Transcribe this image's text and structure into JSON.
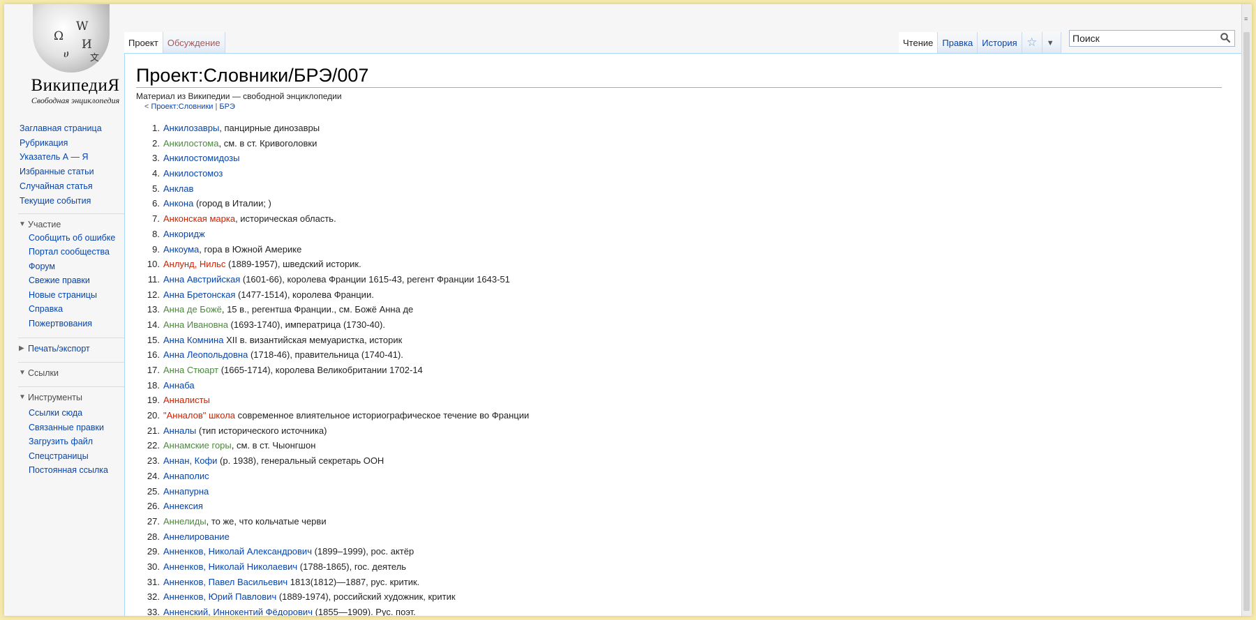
{
  "logo": {
    "wordmark": "ВикипедиЯ",
    "tagline": "Свободная энциклопедия",
    "glyphs": [
      "Ω",
      "W",
      "И",
      "ሀ",
      "文"
    ]
  },
  "sidebar": {
    "main_links": [
      "Заглавная страница",
      "Рубрикация",
      "Указатель А — Я",
      "Избранные статьи",
      "Случайная статья",
      "Текущие события"
    ],
    "participate": {
      "title": "Участие",
      "links": [
        "Сообщить об ошибке",
        "Портал сообщества",
        "Форум",
        "Свежие правки",
        "Новые страницы",
        "Справка",
        "Пожертвования"
      ]
    },
    "print_export": {
      "title": "Печать/экспорт"
    },
    "links_section": {
      "title": "Ссылки"
    },
    "tools": {
      "title": "Инструменты",
      "links": [
        "Ссылки сюда",
        "Связанные правки",
        "Загрузить файл",
        "Спецстраницы",
        "Постоянная ссылка"
      ]
    }
  },
  "tabs": {
    "project": "Проект",
    "discussion": "Обсуждение",
    "read": "Чтение",
    "edit": "Правка",
    "history": "История"
  },
  "search": {
    "placeholder": "Поиск"
  },
  "page": {
    "title": "Проект:Словники/БРЭ/007",
    "subtitle": "Материал из Википедии — свободной энциклопедии",
    "breadcrumb_prefix": "< ",
    "breadcrumb_link1": "Проект:Словники",
    "breadcrumb_sep": " | ",
    "breadcrumb_link2": "БРЭ"
  },
  "colors": {
    "link_blue": "#0645ad",
    "link_green": "#4b8a3c",
    "link_red": "#cc2200",
    "page_border": "#f6eab0"
  },
  "entries": [
    {
      "num": "1.",
      "link": "Анкилозавры",
      "color": "blue",
      "text": ", панцирные динозавры"
    },
    {
      "num": "2.",
      "link": "Анкилостома",
      "color": "green",
      "text": ", см. в ст. Кривоголовки"
    },
    {
      "num": "3.",
      "link": "Анкилостомидозы",
      "color": "blue",
      "text": ""
    },
    {
      "num": "4.",
      "link": "Анкилостомоз",
      "color": "blue",
      "text": ""
    },
    {
      "num": "5.",
      "link": "Анклав",
      "color": "blue",
      "text": ""
    },
    {
      "num": "6.",
      "link": "Анкона",
      "color": "blue",
      "text": " (город в Италии; )"
    },
    {
      "num": "7.",
      "link": "Анконская марка",
      "color": "red",
      "text": ", историческая область."
    },
    {
      "num": "8.",
      "link": "Анкоридж",
      "color": "blue",
      "text": ""
    },
    {
      "num": "9.",
      "link": "Анкоума",
      "color": "blue",
      "text": ", гора в Южной Америке"
    },
    {
      "num": "10.",
      "link": "Анлунд, Нильс",
      "color": "red",
      "text": " (1889-1957), шведский историк."
    },
    {
      "num": "11.",
      "link": "Анна Австрийская",
      "color": "blue",
      "text": " (1601-66), королева Франции 1615-43, регент Франции 1643-51"
    },
    {
      "num": "12.",
      "link": "Анна Бретонская",
      "color": "blue",
      "text": " (1477-1514), королева Франции."
    },
    {
      "num": "13.",
      "link": "Анна де Божё",
      "color": "green",
      "text": ", 15 в., регентша Франции., см. Божё Анна де"
    },
    {
      "num": "14.",
      "link": "Анна Ивановна",
      "color": "green",
      "text": " (1693-1740), императрица (1730-40)."
    },
    {
      "num": "15.",
      "link": "Анна Комнина",
      "color": "blue",
      "text": " XII в. византийская мемуаристка, историк"
    },
    {
      "num": "16.",
      "link": "Анна Леопольдовна",
      "color": "blue",
      "text": " (1718-46), правительница (1740-41)."
    },
    {
      "num": "17.",
      "link": "Анна Стюарт",
      "color": "green",
      "text": " (1665-1714), королева Великобритании 1702-14"
    },
    {
      "num": "18.",
      "link": "Аннаба",
      "color": "blue",
      "text": ""
    },
    {
      "num": "19.",
      "link": "Анналисты",
      "color": "red",
      "text": ""
    },
    {
      "num": "20.",
      "link": "\"Анналов\" школа",
      "color": "red",
      "text": " современное влиятельное историографическое течение во Франции"
    },
    {
      "num": "21.",
      "link": "Анналы",
      "color": "blue",
      "text": " (тип исторического источника)"
    },
    {
      "num": "22.",
      "link": "Аннамские горы",
      "color": "green",
      "text": ", см. в ст. Чыонгшон"
    },
    {
      "num": "23.",
      "link": "Аннан, Кофи",
      "color": "blue",
      "text": " (р. 1938), генеральный секретарь ООН"
    },
    {
      "num": "24.",
      "link": "Аннаполис",
      "color": "blue",
      "text": ""
    },
    {
      "num": "25.",
      "link": "Аннапурна",
      "color": "blue",
      "text": ""
    },
    {
      "num": "26.",
      "link": "Аннексия",
      "color": "blue",
      "text": ""
    },
    {
      "num": "27.",
      "link": "Аннелиды",
      "color": "green",
      "text": ", то же, что кольчатые черви"
    },
    {
      "num": "28.",
      "link": "Аннелирование",
      "color": "blue",
      "text": ""
    },
    {
      "num": "29.",
      "link": "Анненков, Николай Александрович",
      "color": "blue",
      "text": " (1899–1999), рос. актёр"
    },
    {
      "num": "30.",
      "link": "Анненков, Николай Николаевич",
      "color": "blue",
      "text": " (1788-1865), гос. деятель"
    },
    {
      "num": "31.",
      "link": "Анненков, Павел Васильевич",
      "color": "blue",
      "text": " 1813(1812)—1887, рус. критик."
    },
    {
      "num": "32.",
      "link": "Анненков, Юрий Павлович",
      "color": "blue",
      "text": " (1889-1974), российский художник, критик"
    },
    {
      "num": "33.",
      "link": "Анненский, Иннокентий Фёдорович",
      "color": "blue",
      "text": " (1855—1909). Рус. поэт."
    }
  ]
}
